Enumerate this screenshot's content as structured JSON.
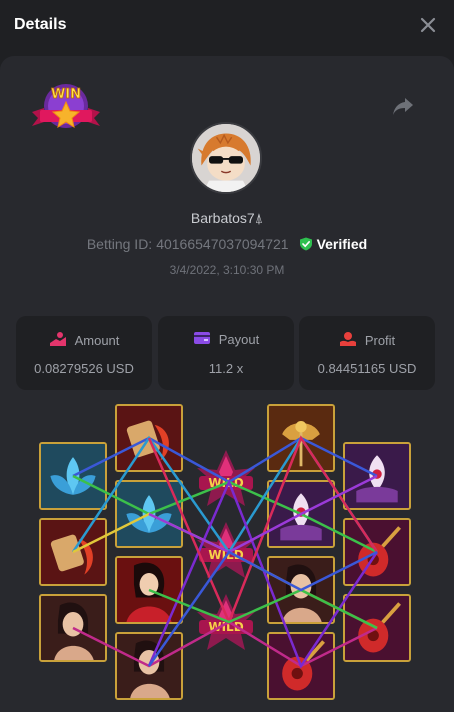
{
  "header": {
    "title": "Details"
  },
  "user": {
    "name": "Barbatos7⍋"
  },
  "bet": {
    "id_label": "Betting ID:",
    "id_value": "40166547037094721",
    "verified_label": "Verified",
    "timestamp": "3/4/2022, 3:10:30 PM"
  },
  "badge": {
    "text": "WIN"
  },
  "stats": {
    "amount": {
      "label": "Amount",
      "value": "0.08279526 USD"
    },
    "payout": {
      "label": "Payout",
      "value": "11.2 x"
    },
    "profit": {
      "label": "Profit",
      "value": "0.84451165 USD"
    }
  },
  "wild_text": "WILD",
  "colors": {
    "panel": "#28292e",
    "card": "#1f2023",
    "verified": "#2ec04f",
    "tile_border": "#c9a13a"
  }
}
